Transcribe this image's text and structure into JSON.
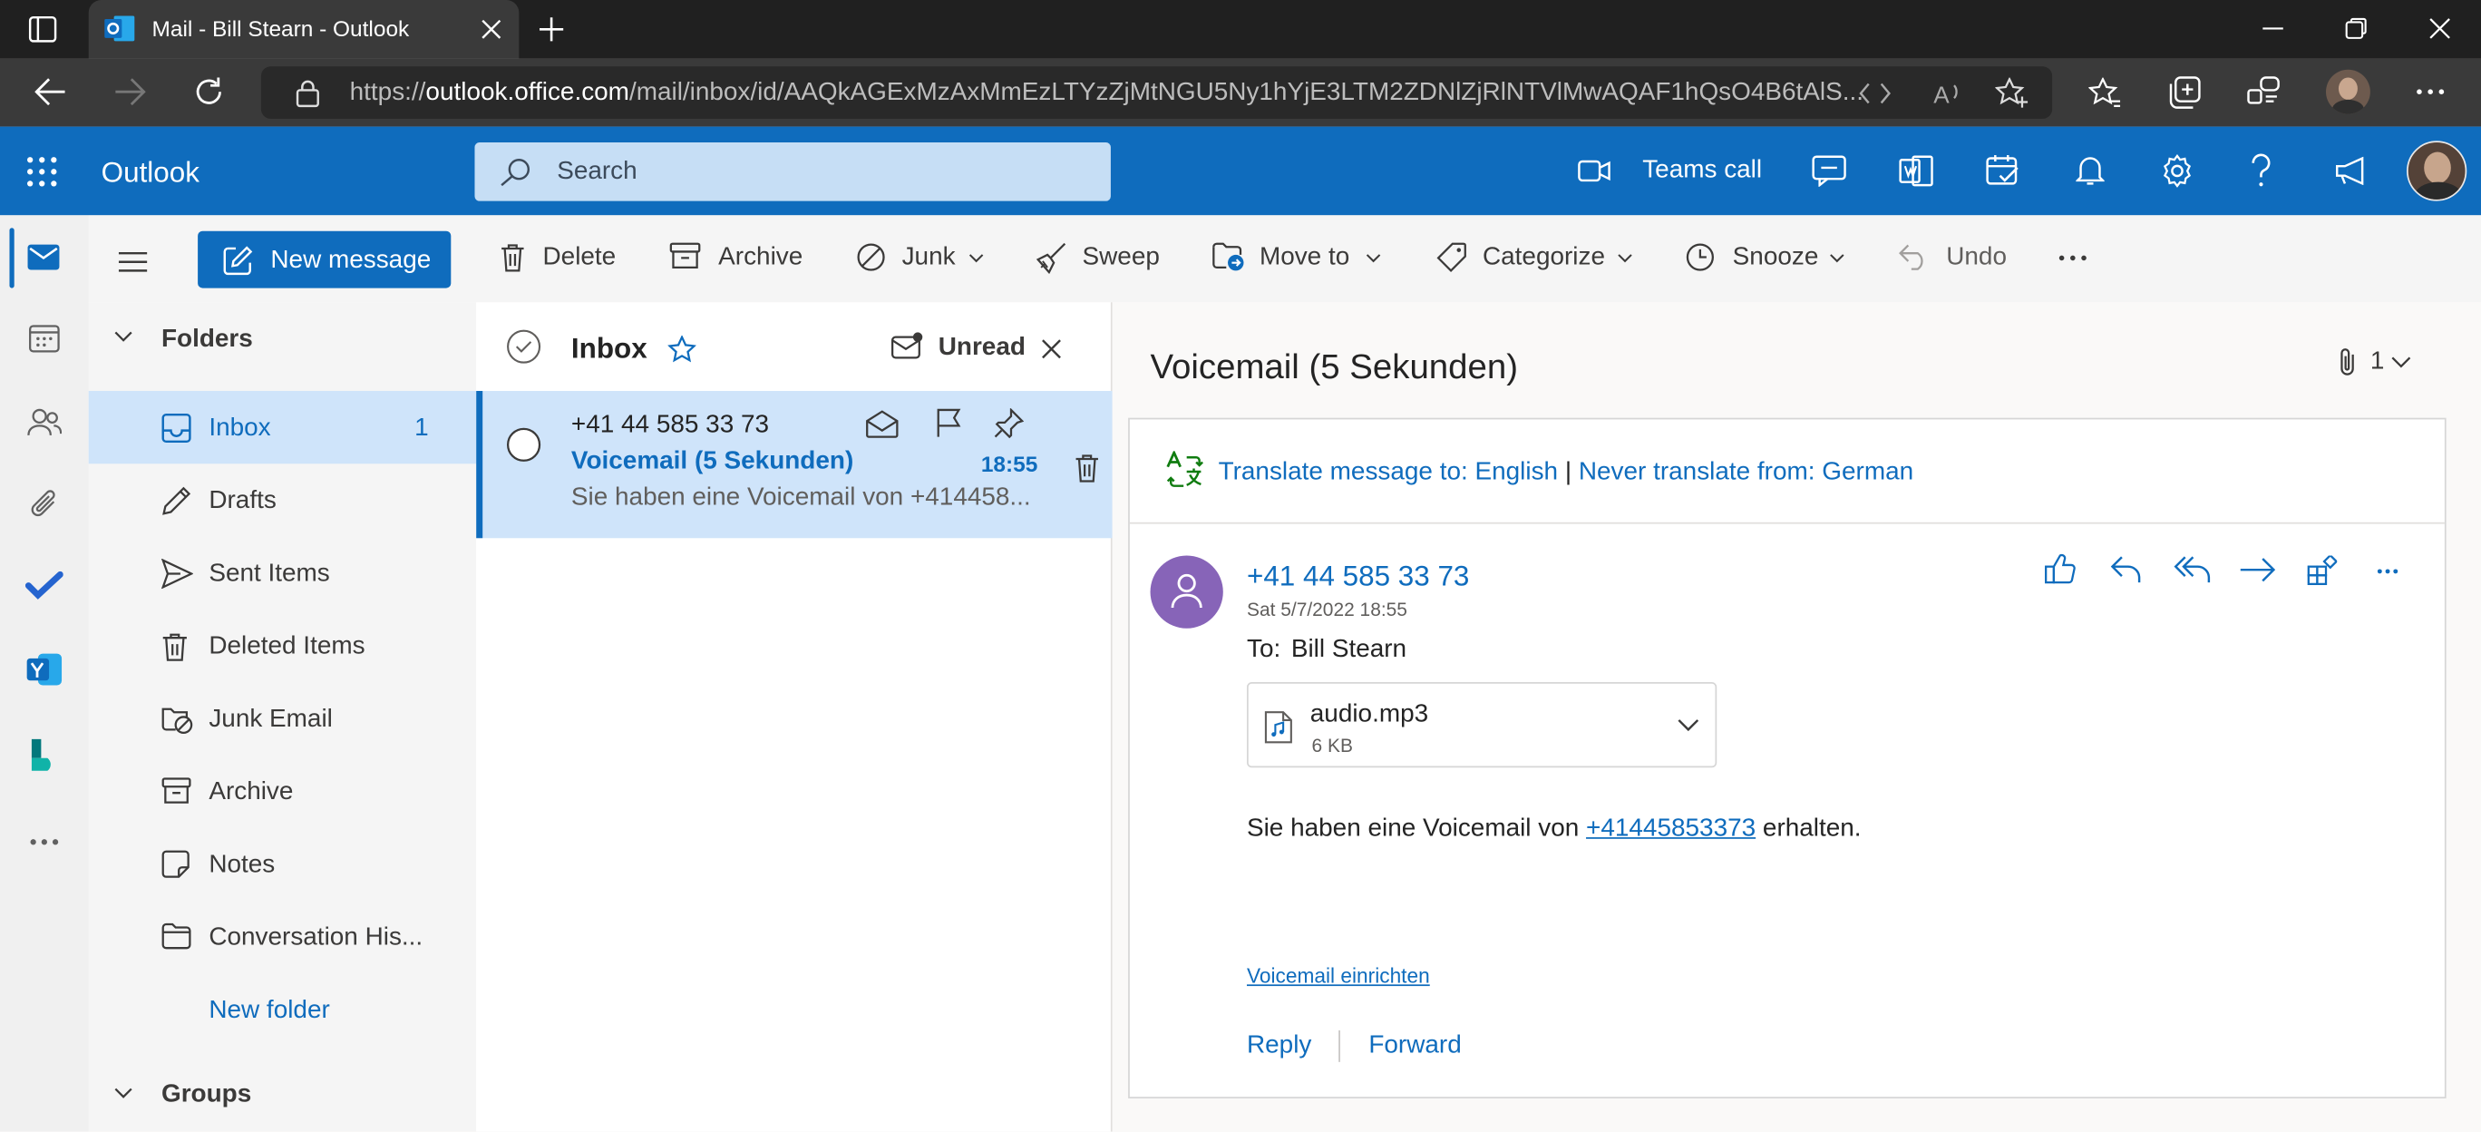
{
  "browser": {
    "tab_title": "Mail - Bill Stearn - Outlook",
    "url_prefix": "https://",
    "url_host": "outlook.office.com",
    "url_path": "/mail/inbox/id/AAQkAGExMzAxMmEzLTYzZjMtNGU5Ny1hYjE3LTM2ZDNlZjRlNTVlMwAQAF1hQsO4B6tAlS..."
  },
  "header": {
    "app_name": "Outlook",
    "search_placeholder": "Search",
    "teams_call": "Teams call"
  },
  "toolbar": {
    "new_message": "New message",
    "delete": "Delete",
    "archive": "Archive",
    "junk": "Junk",
    "sweep": "Sweep",
    "move_to": "Move to",
    "categorize": "Categorize",
    "snooze": "Snooze",
    "undo": "Undo"
  },
  "folders": {
    "heading": "Folders",
    "items": [
      {
        "label": "Inbox",
        "count": "1"
      },
      {
        "label": "Drafts"
      },
      {
        "label": "Sent Items"
      },
      {
        "label": "Deleted Items"
      },
      {
        "label": "Junk Email"
      },
      {
        "label": "Archive"
      },
      {
        "label": "Notes"
      },
      {
        "label": "Conversation His..."
      }
    ],
    "new_folder": "New folder",
    "groups": "Groups"
  },
  "message_list": {
    "title": "Inbox",
    "filter": "Unread",
    "items": [
      {
        "sender": "+41 44 585 33 73",
        "subject": "Voicemail (5 Sekunden)",
        "time": "18:55",
        "preview": "Sie haben eine Voicemail von +414458..."
      }
    ]
  },
  "reading": {
    "subject": "Voicemail (5 Sekunden)",
    "attachment_count": "1",
    "translate_to": "Translate message to: English",
    "translate_sep": "|",
    "never_translate": "Never translate from: German",
    "from": "+41 44 585 33 73",
    "date": "Sat 5/7/2022 18:55",
    "to_label": "To:",
    "to_name": "Bill Stearn",
    "attachment": {
      "name": "audio.mp3",
      "size": "6 KB"
    },
    "body_before": "Sie haben eine Voicemail von ",
    "body_number": "+41445853373",
    "body_after": " erhalten.",
    "setup_link": "Voicemail einrichten",
    "reply": "Reply",
    "forward": "Forward"
  },
  "colors": {
    "brand": "#0f6cbd",
    "selected": "#cfe4fa",
    "avatar": "#8764b8",
    "translate_green": "#107c10"
  }
}
